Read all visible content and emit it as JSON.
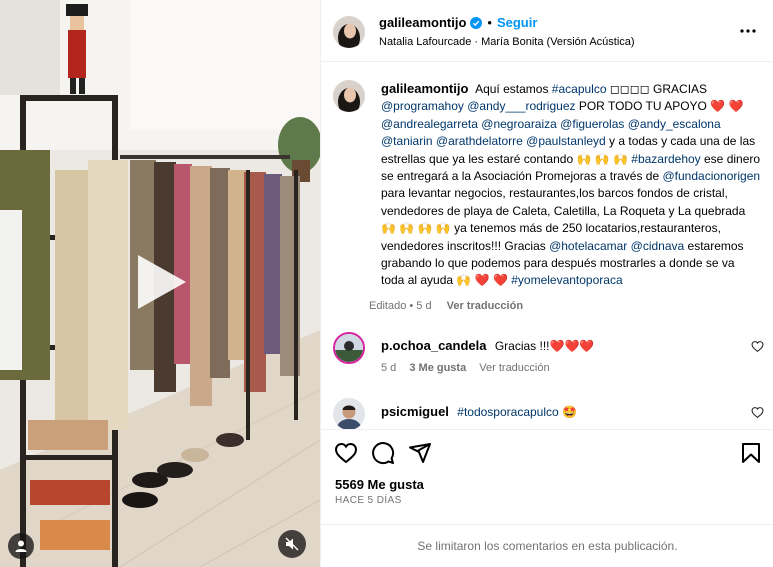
{
  "post": {
    "username": "galileamontijo",
    "separator": "•",
    "follow_label": "Seguir",
    "audio": "Natalia Lafourcade · María Bonita (Versión Acústica)"
  },
  "caption": {
    "username": "galileamontijo",
    "segments": [
      {
        "t": "Aquí estamos "
      },
      {
        "t": "#acapulco",
        "k": "hash"
      },
      {
        "t": " ◻◻◻◻ GRACIAS "
      },
      {
        "t": "@programahoy",
        "k": "link"
      },
      {
        "t": " "
      },
      {
        "t": "@andy___rodriguez",
        "k": "link"
      },
      {
        "t": " POR TODO TU APOYO ❤️ ❤️ "
      },
      {
        "t": "@andrealegarreta",
        "k": "link"
      },
      {
        "t": " "
      },
      {
        "t": "@negroaraiza",
        "k": "link"
      },
      {
        "t": " "
      },
      {
        "t": "@figuerolas",
        "k": "link"
      },
      {
        "t": " "
      },
      {
        "t": "@andy_escalona",
        "k": "link"
      },
      {
        "t": " "
      },
      {
        "t": "@taniarin",
        "k": "link"
      },
      {
        "t": " "
      },
      {
        "t": "@arathdelatorre",
        "k": "link"
      },
      {
        "t": " "
      },
      {
        "t": "@paulstanleyd",
        "k": "link"
      },
      {
        "t": " y a todas y cada una de las estrellas que ya les estaré contando 🙌 🙌 🙌 "
      },
      {
        "t": "#bazardehoy",
        "k": "hash"
      },
      {
        "t": " ese dinero se entregará a la Asociación Promejoras a través de "
      },
      {
        "t": "@fundacionorigen",
        "k": "link"
      },
      {
        "t": " para levantar negocios, restaurantes,los barcos fondos de cristal, vendedores de playa de Caleta, Caletilla, La Roqueta y La quebrada 🙌 🙌 🙌 🙌 ya tenemos más de 250 locatarios,restauranteros, vendedores inscritos!!! Gracias "
      },
      {
        "t": "@hotelacamar",
        "k": "link"
      },
      {
        "t": " "
      },
      {
        "t": "@cidnava",
        "k": "link"
      },
      {
        "t": " estaremos grabando lo que podemos para después mostrarles a donde se va toda al ayuda 🙌 ❤️ ❤️ "
      },
      {
        "t": "#yomelevantoporaca",
        "k": "hash"
      }
    ],
    "edited": "Editado • 5 d",
    "translate": "Ver traducción"
  },
  "comments": [
    {
      "username": "p.ochoa_candela",
      "text": "Gracias !!!❤️❤️❤️",
      "age": "5 d",
      "likes": "3 Me gusta",
      "translate": "Ver traducción"
    },
    {
      "username": "psicmiguel",
      "text": "#todosporacapulco 🤩",
      "text_kind": "hash"
    }
  ],
  "actions": {
    "likes": "5569 Me gusta",
    "time_ago": "HACE 5 DÍAS"
  },
  "footer": {
    "comments_limited": "Se limitaron los comentarios en esta publicación."
  },
  "icons": {
    "more": "more-options-icon",
    "like": "heart-icon",
    "comment": "comment-icon",
    "share": "share-icon",
    "save": "bookmark-icon",
    "play": "play-icon",
    "mute": "muted-speaker-icon",
    "tagged": "user-tag-icon",
    "verified": "verified-badge-icon"
  },
  "colors": {
    "accent": "#0095f6",
    "link": "#00376b",
    "secondary_text": "#737373"
  }
}
